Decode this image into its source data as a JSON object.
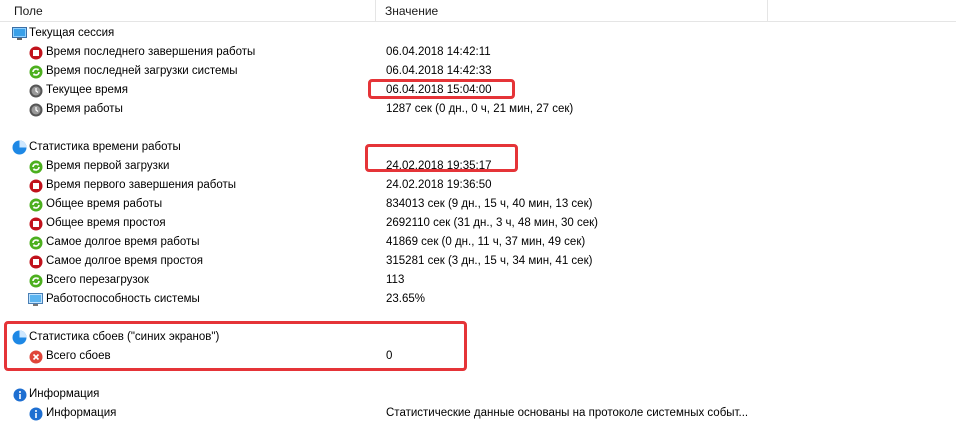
{
  "header": {
    "field": "Поле",
    "value": "Значение"
  },
  "groups": [
    {
      "title": "Текущая сессия",
      "icon": "monitor-session-icon",
      "items": [
        {
          "label": "Время последнего завершения работы",
          "value": "06.04.2018 14:42:11",
          "icon": "stop-icon"
        },
        {
          "label": "Время последней загрузки системы",
          "value": "06.04.2018 14:42:33",
          "icon": "refresh-icon"
        },
        {
          "label": "Текущее время",
          "value": "06.04.2018 15:04:00",
          "icon": "clock-icon"
        },
        {
          "label": "Время работы",
          "value": "1287 сек (0 дн., 0 ч, 21 мин, 27 сек)",
          "icon": "clock-icon"
        }
      ]
    },
    {
      "title": "Статистика времени работы",
      "icon": "pie-chart-icon",
      "items": [
        {
          "label": "Время первой загрузки",
          "value": "24.02.2018 19:35:17",
          "icon": "refresh-icon"
        },
        {
          "label": "Время первого завершения работы",
          "value": "24.02.2018 19:36:50",
          "icon": "stop-icon"
        },
        {
          "label": "Общее время работы",
          "value": "834013 сек (9 дн., 15 ч, 40 мин, 13 сек)",
          "icon": "refresh-icon"
        },
        {
          "label": "Общее время простоя",
          "value": "2692110 сек (31 дн., 3 ч, 48 мин, 30 сек)",
          "icon": "stop-icon"
        },
        {
          "label": "Самое долгое время работы",
          "value": "41869 сек (0 дн., 11 ч, 37 мин, 49 сек)",
          "icon": "refresh-icon"
        },
        {
          "label": "Самое долгое время простоя",
          "value": "315281 сек (3 дн., 15 ч, 34 мин, 41 сек)",
          "icon": "stop-icon"
        },
        {
          "label": "Всего перезагрузок",
          "value": "113",
          "icon": "refresh-icon"
        },
        {
          "label": "Работоспособность системы",
          "value": "23.65%",
          "icon": "monitor-icon"
        }
      ]
    },
    {
      "title": "Статистика сбоев (\"синих экранов\")",
      "icon": "pie-chart-icon",
      "items": [
        {
          "label": "Всего сбоев",
          "value": "0",
          "icon": "error-icon"
        }
      ]
    },
    {
      "title": "Информация",
      "icon": "info-icon",
      "items": [
        {
          "label": "Информация",
          "value": "Статистические данные основаны на протоколе системных событ...",
          "icon": "info-icon"
        }
      ]
    }
  ],
  "colors": {
    "highlight": "#e53438",
    "stop": "#c1121c",
    "refresh": "#4caf1e",
    "clock": "#555555",
    "info": "#1e6fd1",
    "pie": "#1e88e5"
  }
}
